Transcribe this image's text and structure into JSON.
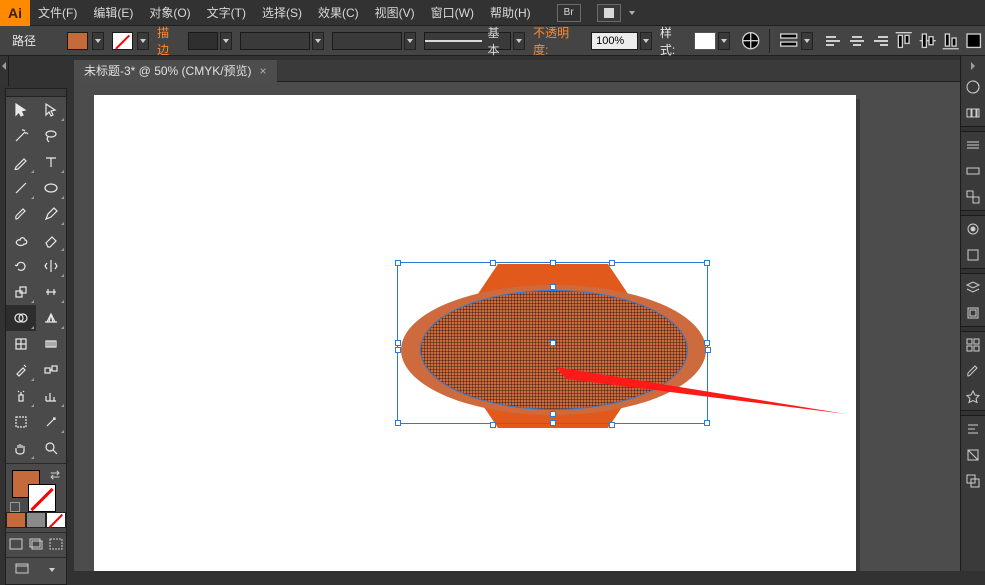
{
  "app_logo": "Ai",
  "menus": {
    "file": "文件(F)",
    "edit": "编辑(E)",
    "object": "对象(O)",
    "type": "文字(T)",
    "select": "选择(S)",
    "effect": "效果(C)",
    "view": "视图(V)",
    "window": "窗口(W)",
    "help": "帮助(H)"
  },
  "bridge_label": "Br",
  "selection_label": "路径",
  "options": {
    "stroke_label": "描边",
    "stroke_weight": "",
    "brush_label": "基本",
    "opacity_label": "不透明度:",
    "opacity_value": "100%",
    "style_label": "样式:"
  },
  "doc_tab": {
    "title": "未标题-3* @ 50% (CMYK/预览)",
    "close": "×"
  },
  "colors": {
    "fill": "#c56a3a",
    "shape_hex": "#e25a1b",
    "shape_ellipse": "#ce6b3e",
    "selection": "#2b7bd6"
  }
}
